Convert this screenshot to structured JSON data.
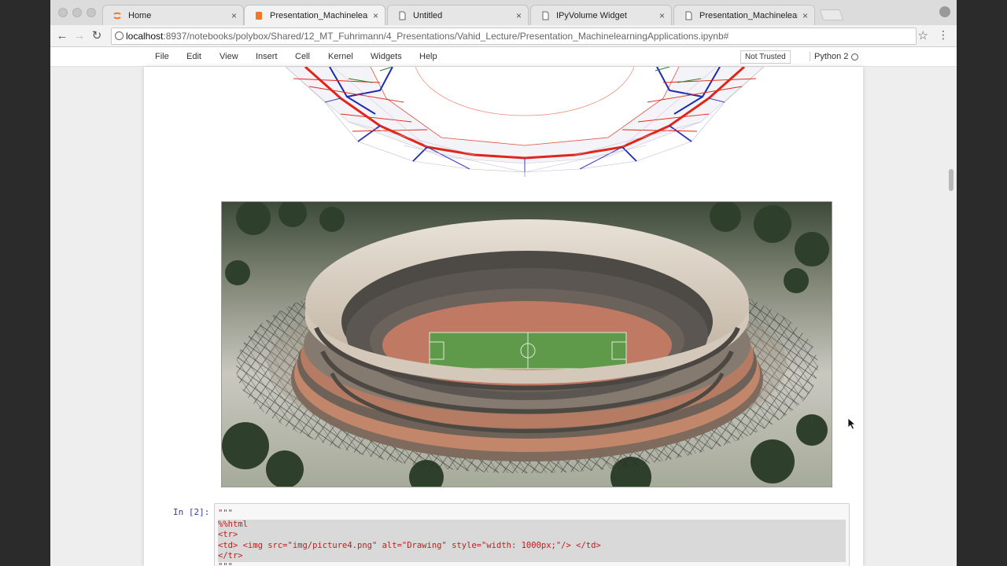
{
  "browser": {
    "tabs": [
      {
        "label": "Home",
        "icon": "jupyter-icon",
        "active": false
      },
      {
        "label": "Presentation_Machinelearning",
        "icon": "notebook-icon",
        "active": true
      },
      {
        "label": "Untitled",
        "icon": "page-icon",
        "active": false
      },
      {
        "label": "IPyVolume Widget",
        "icon": "page-icon",
        "active": false
      },
      {
        "label": "Presentation_Machinelearning",
        "icon": "page-icon",
        "active": false
      }
    ],
    "url_host": "localhost",
    "url_path": ":8937/notebooks/polybox/Shared/12_MT_Fuhrimann/4_Presentations/Vahid_Lecture/Presentation_MachinelearningApplications.ipynb#"
  },
  "jupyter": {
    "menu": [
      "File",
      "Edit",
      "View",
      "Insert",
      "Cell",
      "Kernel",
      "Widgets",
      "Help"
    ],
    "trust_status": "Not Trusted",
    "kernel": "Python 2",
    "cell_prompt": "In [2]:",
    "code_lines": [
      "\"\"\"",
      "%%html",
      "<tr>",
      "<td> <img src=\"img/picture4.png\" alt=\"Drawing\" style=\"width: 1000px;\"/> </td>",
      "</tr>",
      "\"\"\""
    ]
  },
  "colors": {
    "red_member": "#e0261b",
    "blue_member": "#1c2cb0",
    "prompt_blue": "#303f9f"
  }
}
